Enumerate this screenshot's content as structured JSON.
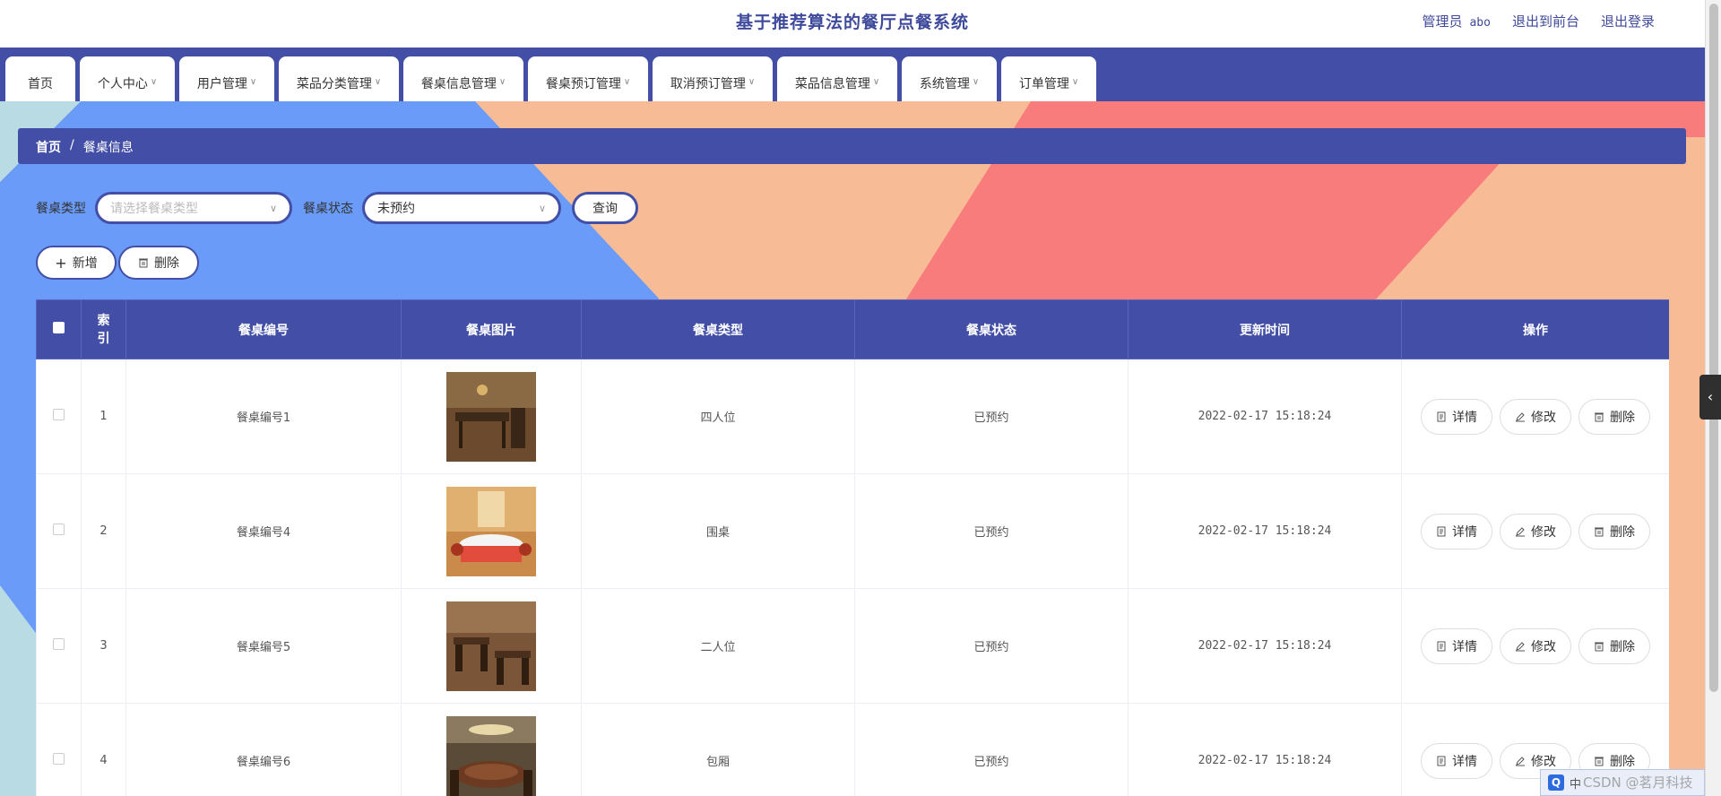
{
  "header": {
    "title": "基于推荐算法的餐厅点餐系统",
    "role": "管理员",
    "username": "abo",
    "back_to_front": "退出到前台",
    "logout": "退出登录"
  },
  "nav": {
    "items": [
      {
        "label": "首页"
      },
      {
        "label": "个人中心"
      },
      {
        "label": "用户管理"
      },
      {
        "label": "菜品分类管理"
      },
      {
        "label": "餐桌信息管理"
      },
      {
        "label": "餐桌预订管理"
      },
      {
        "label": "取消预订管理"
      },
      {
        "label": "菜品信息管理"
      },
      {
        "label": "系统管理"
      },
      {
        "label": "订单管理"
      }
    ]
  },
  "breadcrumb": {
    "home": "首页",
    "separator": "/",
    "current": "餐桌信息"
  },
  "filters": {
    "type_label": "餐桌类型",
    "type_placeholder": "请选择餐桌类型",
    "state_label": "餐桌状态",
    "state_value": "未预约",
    "query_button": "查询"
  },
  "actions": {
    "add_label": "新增",
    "delete_label": "删除"
  },
  "table": {
    "headers": {
      "index": "索引",
      "code": "餐桌编号",
      "image": "餐桌图片",
      "type": "餐桌类型",
      "state": "餐桌状态",
      "updated": "更新时间",
      "ops": "操作"
    },
    "rows": [
      {
        "index": "1",
        "code": "餐桌编号1",
        "type": "四人位",
        "state": "已预约",
        "updated": "2022-02-17 15:18:24"
      },
      {
        "index": "2",
        "code": "餐桌编号4",
        "type": "围桌",
        "state": "已预约",
        "updated": "2022-02-17 15:18:24"
      },
      {
        "index": "3",
        "code": "餐桌编号5",
        "type": "二人位",
        "state": "已预约",
        "updated": "2022-02-17 15:18:24"
      },
      {
        "index": "4",
        "code": "餐桌编号6",
        "type": "包厢",
        "state": "已预约",
        "updated": "2022-02-17 15:18:24"
      }
    ],
    "op_labels": {
      "detail": "详情",
      "edit": "修改",
      "delete": "删除"
    }
  },
  "widget": {
    "ime_char": "中",
    "watermark": "CSDN @茗月科技"
  },
  "colors": {
    "primary": "#434fa6",
    "bg_blue": "#6a9bf8",
    "bg_peach": "#f7bb95",
    "bg_coral": "#f97c7d",
    "bg_light": "#b9dbe3"
  }
}
